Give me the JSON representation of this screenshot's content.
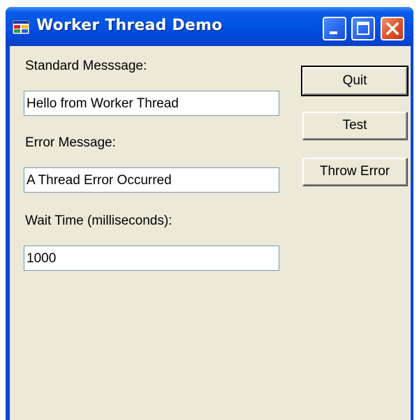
{
  "window": {
    "title": "Worker Thread Demo",
    "app_icon": "form-icon",
    "controls": {
      "minimize_icon": "minimize-icon",
      "maximize_icon": "maximize-icon",
      "close_icon": "close-icon"
    }
  },
  "form": {
    "standard_message": {
      "label": "Standard Messsage:",
      "value": "Hello from Worker Thread"
    },
    "error_message": {
      "label": "Error Message:",
      "value": "A Thread Error Occurred"
    },
    "wait_time": {
      "label": "Wait Time (milliseconds):",
      "value": "1000"
    }
  },
  "buttons": {
    "quit": "Quit",
    "test": "Test",
    "throw_error": "Throw Error"
  },
  "colors": {
    "titlebar": "#0054e3",
    "client_background": "#ece9d8",
    "close_button": "#e0562c"
  }
}
